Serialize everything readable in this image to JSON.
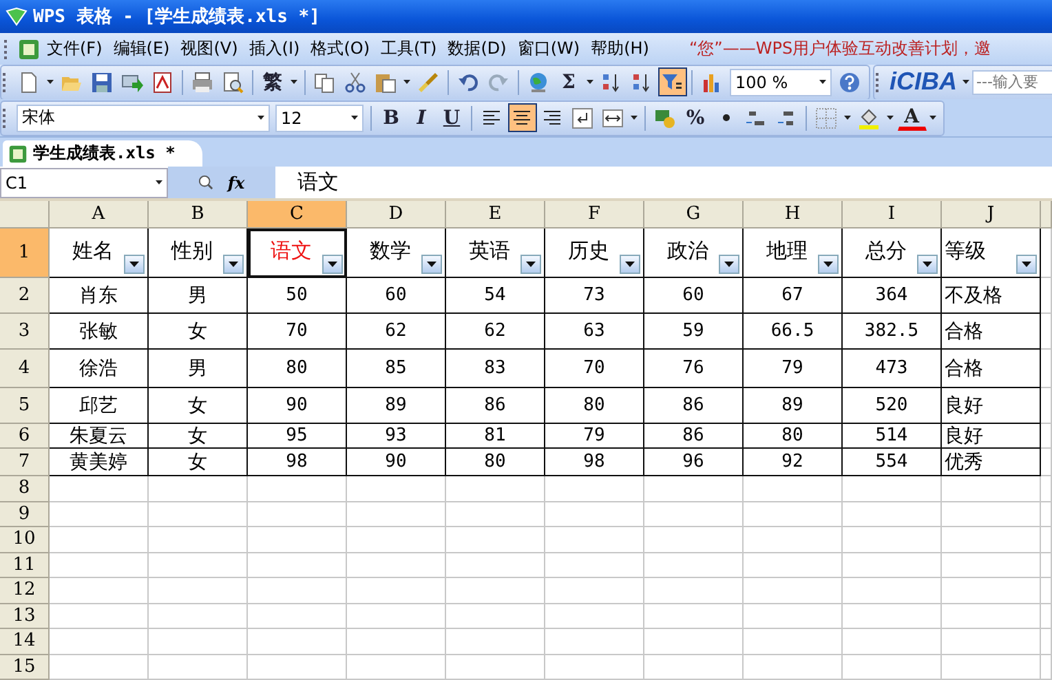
{
  "window": {
    "title": "WPS 表格 - [学生成绩表.xls *]"
  },
  "menu": {
    "items": [
      "文件(F)",
      "编辑(E)",
      "视图(V)",
      "插入(I)",
      "格式(O)",
      "工具(T)",
      "数据(D)",
      "窗口(W)",
      "帮助(H)"
    ],
    "promo": "“您”——WPS用户体验互动改善计划，邀"
  },
  "standard_toolbar": [
    {
      "kind": "new"
    },
    {
      "kind": "dropdown"
    },
    {
      "kind": "open"
    },
    {
      "kind": "save"
    },
    {
      "kind": "mail"
    },
    {
      "kind": "pdf"
    },
    {
      "kind": "sep"
    },
    {
      "kind": "print"
    },
    {
      "kind": "preview"
    },
    {
      "kind": "sep"
    },
    {
      "kind": "text",
      "label": "繁"
    },
    {
      "kind": "dropdown"
    },
    {
      "kind": "sep"
    },
    {
      "kind": "copy"
    },
    {
      "kind": "cut"
    },
    {
      "kind": "paste"
    },
    {
      "kind": "dropdown"
    },
    {
      "kind": "brush"
    },
    {
      "kind": "sep"
    },
    {
      "kind": "undo"
    },
    {
      "kind": "redo"
    },
    {
      "kind": "sep"
    },
    {
      "kind": "globe"
    },
    {
      "kind": "text",
      "label": "Σ"
    },
    {
      "kind": "dropdown"
    },
    {
      "kind": "sort_asc"
    },
    {
      "kind": "sort_desc"
    },
    {
      "kind": "filter",
      "on": true
    },
    {
      "kind": "sep"
    },
    {
      "kind": "chart"
    },
    {
      "kind": "zoom_combo",
      "value": "100 %"
    },
    {
      "kind": "help"
    }
  ],
  "dictionary_toolbar": {
    "logo": "iCIBA",
    "placeholder": "---输入要"
  },
  "format_toolbar": [
    {
      "kind": "font_combo",
      "value": "宋体"
    },
    {
      "kind": "size_combo",
      "value": "12"
    },
    {
      "kind": "sep"
    },
    {
      "kind": "bold",
      "label": "B",
      "on": false
    },
    {
      "kind": "italic",
      "label": "I",
      "on": false
    },
    {
      "kind": "underline",
      "label": "U",
      "on": false
    },
    {
      "kind": "sep"
    },
    {
      "kind": "align_left",
      "on": false
    },
    {
      "kind": "align_center",
      "on": true
    },
    {
      "kind": "align_right",
      "on": false
    },
    {
      "kind": "wrap"
    },
    {
      "kind": "merge"
    },
    {
      "kind": "dropdown"
    },
    {
      "kind": "sep"
    },
    {
      "kind": "currency"
    },
    {
      "kind": "text",
      "label": "%"
    },
    {
      "kind": "comma"
    },
    {
      "kind": "inc_decimal"
    },
    {
      "kind": "dec_decimal"
    },
    {
      "kind": "sep"
    },
    {
      "kind": "borders"
    },
    {
      "kind": "dropdown"
    },
    {
      "kind": "fill_color"
    },
    {
      "kind": "dropdown"
    },
    {
      "kind": "font_color",
      "label": "A"
    },
    {
      "kind": "dropdown"
    }
  ],
  "sheet_tabs": [
    {
      "label": "学生成绩表.xls *",
      "selected": true
    }
  ],
  "formula_bar": {
    "cell": "C1",
    "fx": "fx",
    "value": "语文"
  },
  "grid": {
    "columns": [
      {
        "label": "A",
        "selected": false
      },
      {
        "label": "B",
        "selected": false
      },
      {
        "label": "C",
        "selected": true
      },
      {
        "label": "D",
        "selected": false
      },
      {
        "label": "E",
        "selected": false
      },
      {
        "label": "F",
        "selected": false
      },
      {
        "label": "G",
        "selected": false
      },
      {
        "label": "H",
        "selected": false
      },
      {
        "label": "I",
        "selected": false
      },
      {
        "label": "J",
        "selected": false
      }
    ],
    "rows": [
      {
        "number": "1",
        "selected": true,
        "kind": "header",
        "cells": [
          "姓名",
          "性别",
          "语文",
          "数学",
          "英语",
          "历史",
          "政治",
          "地理",
          "总分",
          "等级"
        ]
      },
      {
        "number": "2",
        "selected": false,
        "kind": "data",
        "cells": [
          "肖东",
          "男",
          "50",
          "60",
          "54",
          "73",
          "60",
          "67",
          "364",
          "不及格"
        ]
      },
      {
        "number": "3",
        "selected": false,
        "kind": "data",
        "cells": [
          "张敏",
          "女",
          "70",
          "62",
          "62",
          "63",
          "59",
          "66.5",
          "382.5",
          "合格"
        ]
      },
      {
        "number": "4",
        "selected": false,
        "kind": "data",
        "cells": [
          "徐浩",
          "男",
          "80",
          "85",
          "83",
          "70",
          "76",
          "79",
          "473",
          "合格"
        ]
      },
      {
        "number": "5",
        "selected": false,
        "kind": "data",
        "cells": [
          "邱艺",
          "女",
          "90",
          "89",
          "86",
          "80",
          "86",
          "89",
          "520",
          "良好"
        ]
      },
      {
        "number": "6",
        "selected": false,
        "kind": "data",
        "cells": [
          "朱夏云",
          "女",
          "95",
          "93",
          "81",
          "79",
          "86",
          "80",
          "514",
          "良好"
        ]
      },
      {
        "number": "7",
        "selected": false,
        "kind": "data",
        "cells": [
          "黄美婷",
          "女",
          "98",
          "90",
          "80",
          "98",
          "96",
          "92",
          "554",
          "优秀"
        ]
      },
      {
        "number": "8",
        "selected": false,
        "kind": "empty"
      },
      {
        "number": "9",
        "selected": false,
        "kind": "empty"
      },
      {
        "number": "10",
        "selected": false,
        "kind": "empty"
      },
      {
        "number": "11",
        "selected": false,
        "kind": "empty"
      },
      {
        "number": "12",
        "selected": false,
        "kind": "empty"
      },
      {
        "number": "13",
        "selected": false,
        "kind": "empty"
      },
      {
        "number": "14",
        "selected": false,
        "kind": "empty"
      },
      {
        "number": "15",
        "selected": false,
        "kind": "empty"
      }
    ]
  }
}
